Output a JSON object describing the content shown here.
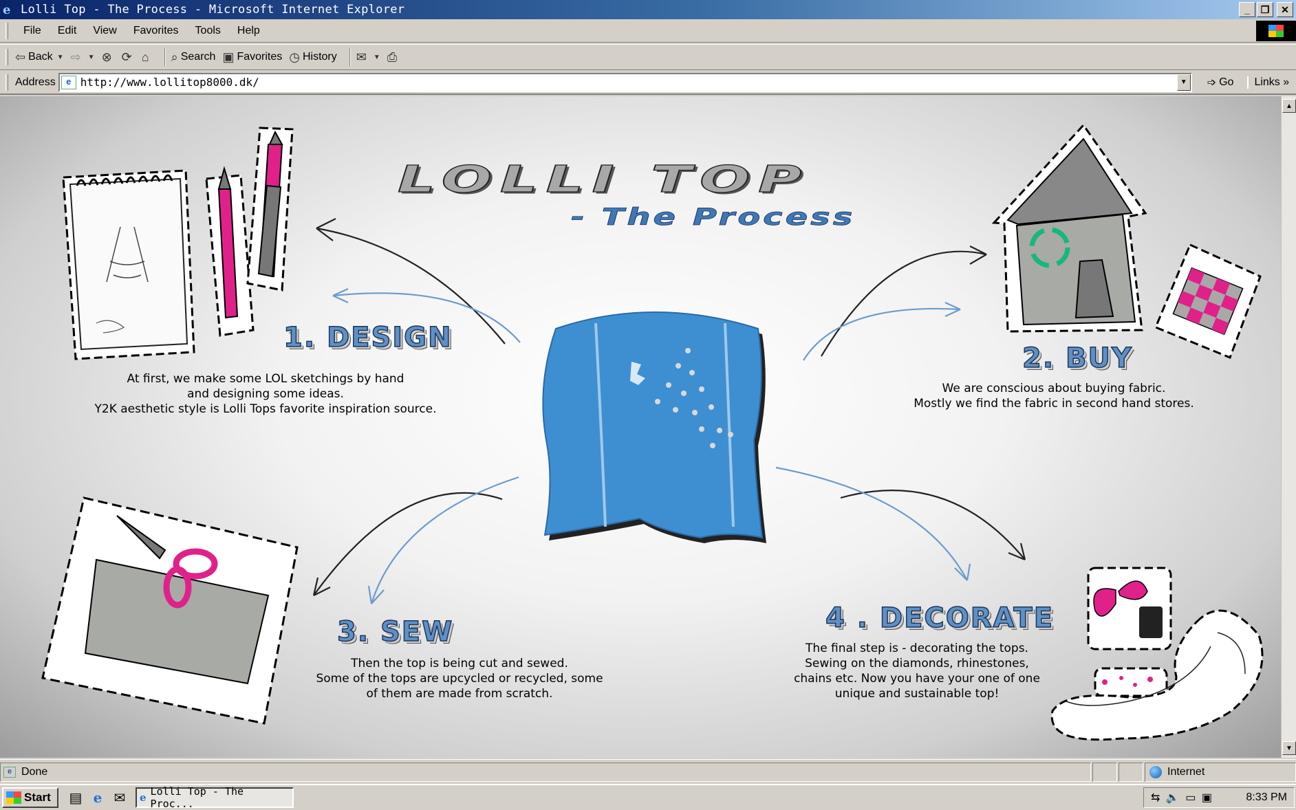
{
  "window": {
    "title": "Lolli Top - The Process - Microsoft Internet Explorer",
    "minimize": "_",
    "restore": "❐",
    "close": "✕"
  },
  "menu": [
    "File",
    "Edit",
    "View",
    "Favorites",
    "Tools",
    "Help"
  ],
  "toolbar": {
    "back": "Back",
    "search": "Search",
    "favorites": "Favorites",
    "history": "History"
  },
  "address": {
    "label": "Address",
    "url": "http://www.lollitop8000.dk/",
    "go": "Go",
    "links": "Links"
  },
  "page": {
    "logo": "LOLLI TOP",
    "subtitle": "- The Process",
    "steps": [
      {
        "title": "1. DESIGN",
        "text": "At first, we make some LOL sketchings by hand\nand designing some ideas.\nY2K aesthetic style is Lolli Tops favorite inspiration source."
      },
      {
        "title": "2. BUY",
        "text": "We are conscious about buying fabric.\nMostly we find the fabric in second hand stores."
      },
      {
        "title": "3. SEW",
        "text": "Then the top is being cut and sewed.\nSome of the tops are upcycled or recycled, some\nof them are made from scratch."
      },
      {
        "title": "4 . DECORATE",
        "text": "The final step is - decorating the tops.\nSewing on the diamonds, rhinestones,\nchains etc. Now you have your one of one\nunique and sustainable top!"
      }
    ],
    "colors": {
      "accent_blue": "#5e90c6",
      "pink": "#e0218a",
      "denim": "#3d8fd1"
    }
  },
  "status": {
    "text": "Done",
    "zone": "Internet"
  },
  "taskbar": {
    "start": "Start",
    "task": "Lolli Top - The Proc...",
    "clock": "8:33 PM"
  }
}
